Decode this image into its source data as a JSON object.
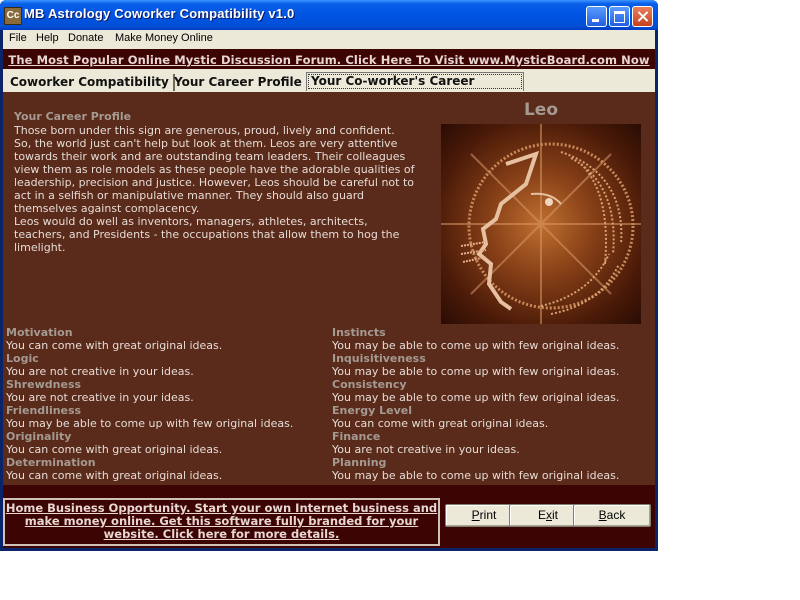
{
  "window": {
    "title": "MB Astrology Coworker Compatibility v1.0",
    "icon_label": "Cc"
  },
  "menu": [
    "File",
    "Help",
    "Donate",
    "Make Money Online"
  ],
  "forum_banner": "The Most Popular Online Mystic Discussion Forum. Click Here To Visit www.MysticBoard.com Now",
  "tabs": [
    {
      "label": "Coworker Compatibility",
      "active": false
    },
    {
      "label": "Your Career Profile",
      "active": false
    },
    {
      "label": "Your Co-worker's Career Profile",
      "active": true
    }
  ],
  "profile": {
    "heading": "Your Career Profile",
    "text": "Those born under this sign are generous, proud, lively and confident.\nSo, the world just can't help but look at them. Leos are very attentive\ntowards their work and are outstanding team leaders. Their colleagues\nview them as role models as these people have the adorable qualities of\nleadership, precision and justice. However, Leos should be careful not to\nact in a selfish or manipulative manner. They should also guard\nthemselves against complacency.\nLeos would do well as inventors, managers, athletes, architects,\nteachers, and Presidents - the occupations that allow them to hog the\nlimelight.",
    "sign": "Leo",
    "sign_image": "leo-lion-head-icon"
  },
  "traits_left": [
    {
      "label": "Motivation",
      "value": "You can come with great original ideas."
    },
    {
      "label": "Logic",
      "value": "You are not creative in your ideas."
    },
    {
      "label": "Shrewdness",
      "value": "You are not creative in your ideas."
    },
    {
      "label": "Friendliness",
      "value": "You may be able to come up with few original ideas."
    },
    {
      "label": "Originality",
      "value": "You can come with great original ideas."
    },
    {
      "label": "Determination",
      "value": "You can come with great original ideas."
    }
  ],
  "traits_right": [
    {
      "label": "Instincts",
      "value": "You may be able to come up with few original ideas."
    },
    {
      "label": "Inquisitiveness",
      "value": "You may be able to come up with few original ideas."
    },
    {
      "label": "Consistency",
      "value": "You may be able to come up with few original ideas."
    },
    {
      "label": "Energy Level",
      "value": "You can come with great original ideas."
    },
    {
      "label": "Finance",
      "value": "You are not creative in your ideas."
    },
    {
      "label": "Planning",
      "value": "You may be able to come up with few original ideas."
    }
  ],
  "promo": "Home Business Opportunity. Start your own Internet business and make money online. Get this software fully branded for your website. Click here for more details.",
  "buttons": {
    "print": {
      "accel": "P",
      "rest": "rint"
    },
    "exit": {
      "pre": "E",
      "accel": "x",
      "rest": "it"
    },
    "back": {
      "accel": "B",
      "rest": "ack"
    }
  },
  "colors": {
    "content_bg": "#5a2a1a",
    "banner_bg": "#3d0404",
    "label_color": "#a59a92",
    "text_color": "#e6dcd6"
  }
}
